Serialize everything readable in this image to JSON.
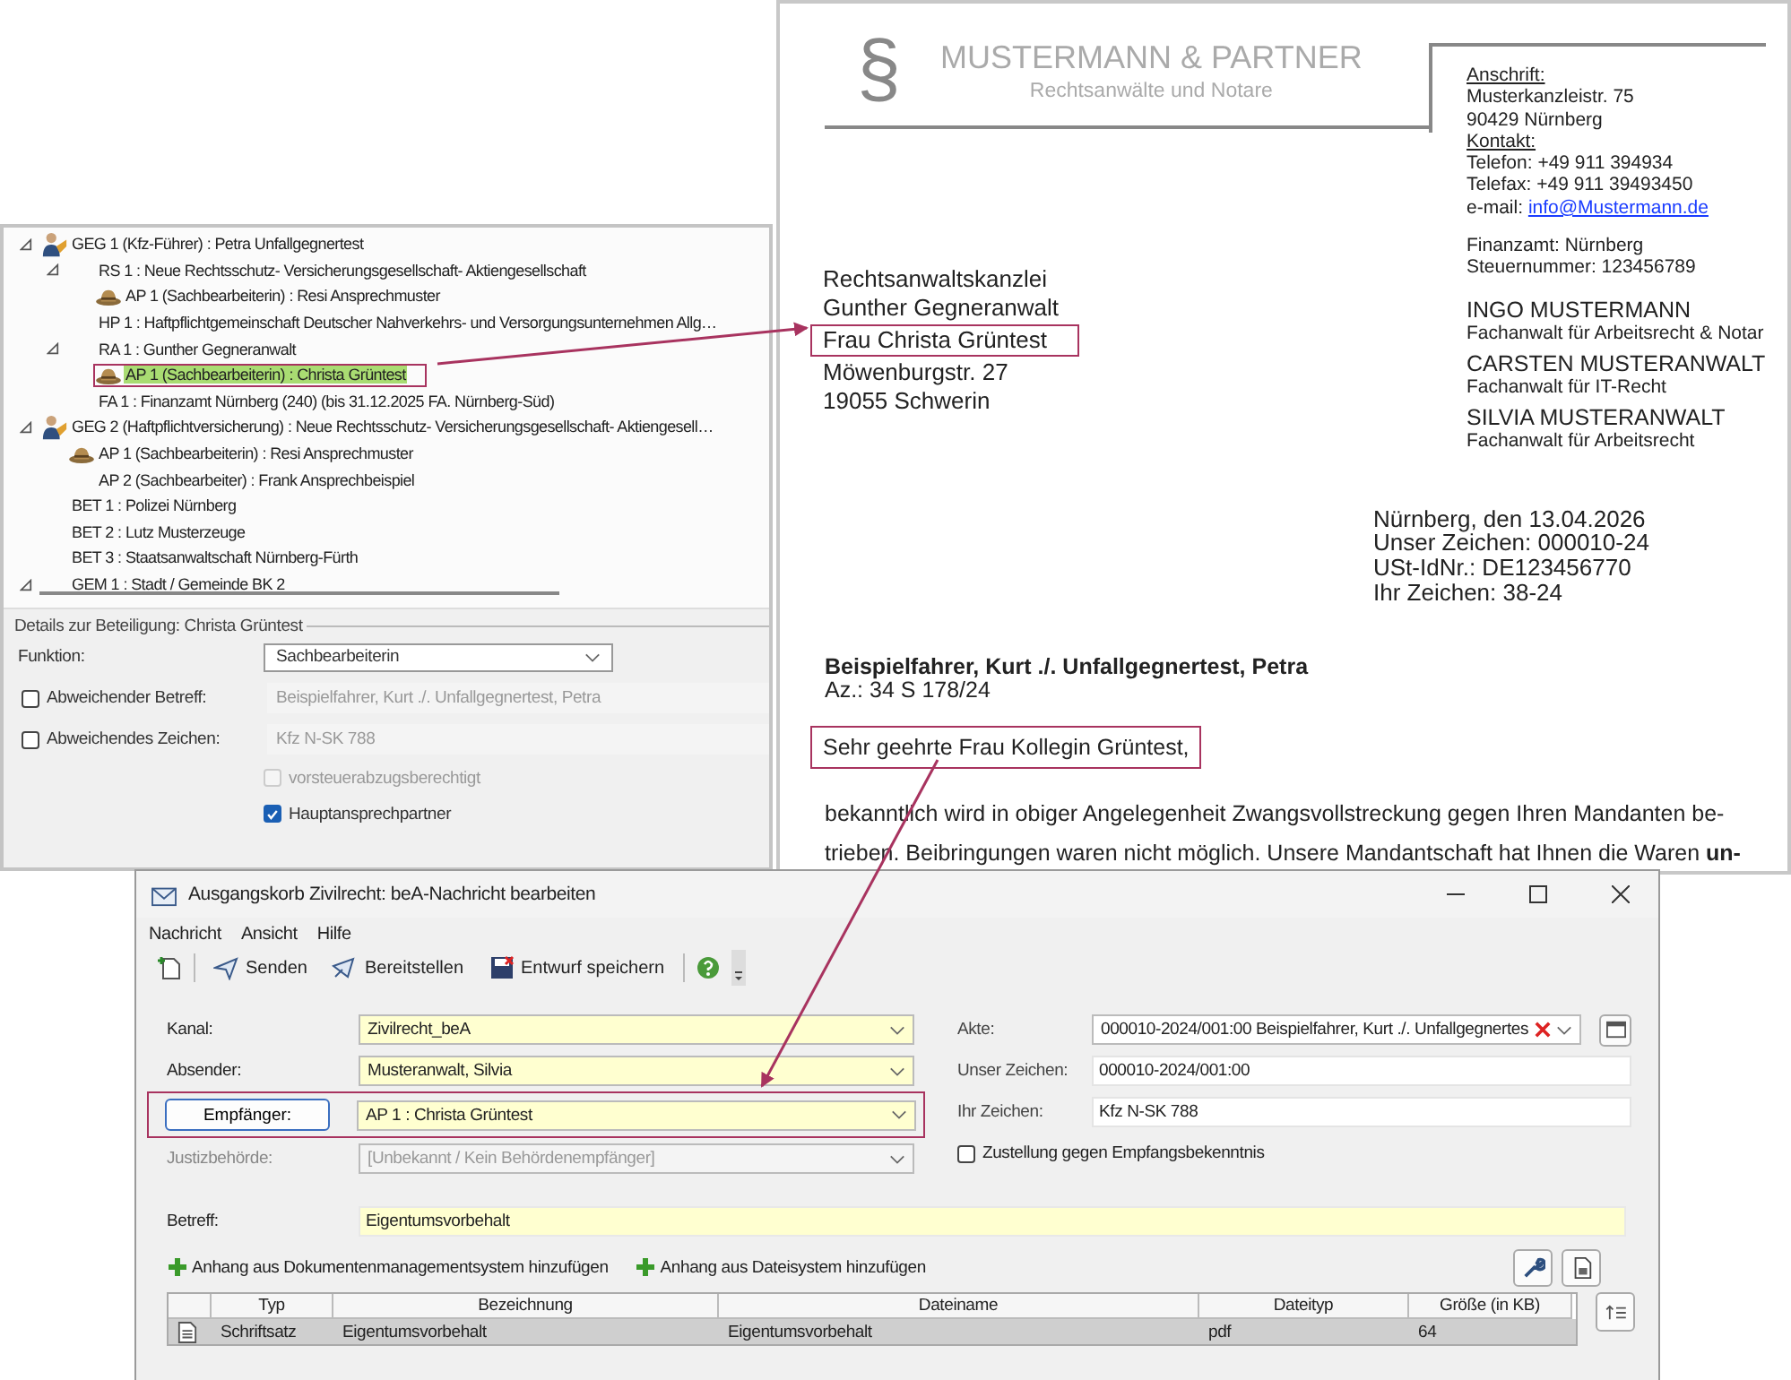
{
  "tree": {
    "items": [
      {
        "label": "GEG 1 (Kfz-Führer) : Petra Unfallgegnertest",
        "kind": "person",
        "selected": false,
        "expanded": true,
        "children": [
          {
            "label": "RS 1 : Neue Rechtsschutz- Versicherungsgesellschaft- Aktiengesellschaft",
            "kind": "plain",
            "selected": false,
            "expanded": true,
            "children": [
              {
                "label": "AP 1 (Sachbearbeiterin) : Resi Ansprechmuster",
                "kind": "hat",
                "selected": false
              }
            ]
          },
          {
            "label": "HP 1 : Haftpflichtgemeinschaft Deutscher Nahverkehrs- und Versorgungsunternehmen Allg…",
            "kind": "plain",
            "selected": false
          },
          {
            "label": "RA 1 : Gunther Gegneranwalt",
            "kind": "plain",
            "selected": false,
            "expanded": true,
            "children": [
              {
                "label": "AP 1 (Sachbearbeiterin) : Christa Grüntest",
                "kind": "hat",
                "selected": true
              }
            ]
          },
          {
            "label": "FA 1 : Finanzamt Nürnberg (240) (bis 31.12.2025 FA. Nürnberg-Süd)",
            "kind": "plain",
            "selected": false
          }
        ]
      },
      {
        "label": "GEG 2 (Haftpflichtversicherung) : Neue Rechtsschutz- Versicherungsgesellschaft- Aktiengesell…",
        "kind": "person",
        "selected": false,
        "expanded": true,
        "children": [
          {
            "label": "AP 1 (Sachbearbeiterin) : Resi Ansprechmuster",
            "kind": "hat",
            "selected": false
          },
          {
            "label": "AP 2 (Sachbearbeiter) : Frank Ansprechbeispiel",
            "kind": "plain",
            "selected": false
          }
        ]
      },
      {
        "label": "BET 1 : Polizei Nürnberg",
        "kind": "plain",
        "selected": false
      },
      {
        "label": "BET 2 : Lutz Musterzeuge",
        "kind": "plain",
        "selected": false
      },
      {
        "label": "BET 3 : Staatsanwaltschaft Nürnberg-Fürth",
        "kind": "plain",
        "selected": false
      },
      {
        "label": "GEM 1 : Stadt / Gemeinde BK 2",
        "kind": "plain",
        "selected": false,
        "expanded": true
      }
    ]
  },
  "details": {
    "title": "Details zur Beteiligung: Christa Grüntest",
    "funktion": {
      "label": "Funktion:",
      "value": "Sachbearbeiterin"
    },
    "overrides": [
      {
        "label": "Abweichender Betreff:",
        "checked": false,
        "value": "Beispielfahrer, Kurt ./. Unfallgegnertest, Petra"
      },
      {
        "label": "Abweichendes Zeichen:",
        "checked": false,
        "value": "Kfz N-SK 788"
      }
    ],
    "options": [
      {
        "label": "vorsteuerabzugsberechtigt",
        "checked": false,
        "disabled": true
      },
      {
        "label": "Hauptansprechpartner",
        "checked": true,
        "disabled": false
      }
    ]
  },
  "letter": {
    "logo_symbol": "§",
    "firm": "MUSTERMANN & PARTNER",
    "tagline": "Rechtsanwälte und Notare",
    "recipient": [
      {
        "text": "Rechtsanwaltskanzlei",
        "callout": false
      },
      {
        "text": "Gunther Gegneranwalt",
        "callout": false
      },
      {
        "text": "Frau Christa Grüntest",
        "callout": true
      },
      {
        "text": "Möwenburgstr. 27",
        "callout": false
      },
      {
        "text": "19055 Schwerin",
        "callout": false
      }
    ],
    "sections": [
      {
        "heading": "Anschrift:",
        "lines": [
          "Musterkanzleistr. 75",
          "90429 Nürnberg"
        ]
      },
      {
        "heading": "Kontakt:",
        "lines": [
          "Telefon: +49 911 394934",
          "Telefax:  +49 911 39493450"
        ],
        "email": {
          "label": "e-mail:",
          "link": "info@Mustermann.de"
        }
      },
      {
        "lines": [
          "Finanzamt: Nürnberg",
          "Steuernummer: 123456789"
        ]
      }
    ],
    "lawyers": [
      {
        "name": "INGO MUSTERMANN",
        "title": "Fachanwalt für Arbeitsrecht & Notar"
      },
      {
        "name": "CARSTEN MUSTERANWALT",
        "title": "Fachanwalt für IT-Recht"
      },
      {
        "name": "SILVIA MUSTERANWALT",
        "title": "Fachanwalt für Arbeitsrecht"
      }
    ],
    "date_block": [
      "Nürnberg, den 13.04.2026",
      "Unser Zeichen: 000010-24",
      "USt-IdNr.: DE123456770",
      "Ihr Zeichen: 38-24"
    ],
    "subject": "Beispielfahrer, Kurt ./. Unfallgegnertest, Petra",
    "reference": "Az.: 34 S 178/24",
    "greeting": {
      "text": "Sehr geehrte Frau Kollegin Grüntest,",
      "callout": true
    },
    "body": [
      "bekanntlich wird in obiger Angelegenheit Zwangsvollstreckung gegen Ihren Mandanten be-",
      "trieben. Beibringungen waren nicht möglich. Unsere Mandantschaft hat Ihnen die Waren **un-**"
    ]
  },
  "dialog": {
    "title": "Ausgangskorb Zivilrecht: beA-Nachricht bearbeiten",
    "menu": [
      "Nachricht",
      "Ansicht",
      "Hilfe"
    ],
    "toolbar": [
      "Senden",
      "Bereitstellen",
      "Entwurf speichern"
    ],
    "left_fields": [
      {
        "kind": "combo",
        "label": "Kanal:",
        "value": "Zivilrecht_beA",
        "mandatory": true,
        "disabled": false,
        "callout": false
      },
      {
        "kind": "combo",
        "label": "Absender:",
        "value": "Musteranwalt, Silvia",
        "mandatory": true,
        "disabled": false,
        "callout": false
      },
      {
        "kind": "button_combo",
        "label": "Empfänger:",
        "value": "AP 1 : Christa Grüntest",
        "mandatory": true,
        "disabled": false,
        "callout": true
      },
      {
        "kind": "combo",
        "label": "Justizbehörde:",
        "value": "[Unbekannt / Kein Behördenempfänger]",
        "mandatory": false,
        "disabled": true,
        "callout": false
      }
    ],
    "right_fields": [
      {
        "kind": "combo_clear",
        "label": "Akte:",
        "value": "000010-2024/001:00  Beispielfahrer, Kurt ./. Unfallgegnertes"
      },
      {
        "kind": "text",
        "label": "Unser Zeichen:",
        "value": "000010-2024/001:00"
      },
      {
        "kind": "text",
        "label": "Ihr Zeichen:",
        "value": "Kfz N-SK 788"
      },
      {
        "kind": "checkbox",
        "label": "Zustellung gegen Empfangsbekenntnis",
        "checked": false
      }
    ],
    "subject": {
      "label": "Betreff:",
      "value": "Eigentumsvorbehalt",
      "mandatory": true
    },
    "attach_links": [
      "Anhang aus Dokumentenmanagementsystem hinzufügen",
      "Anhang aus Dateisystem hinzufügen"
    ],
    "table": {
      "columns": [
        "Typ",
        "Bezeichnung",
        "Dateiname",
        "Dateityp",
        "Größe (in KB)"
      ],
      "rows": [
        {
          "cells": [
            "Schriftsatz",
            "Eigentumsvorbehalt",
            "Eigentumsvorbehalt",
            "pdf",
            "64"
          ],
          "selected": true
        }
      ]
    }
  }
}
